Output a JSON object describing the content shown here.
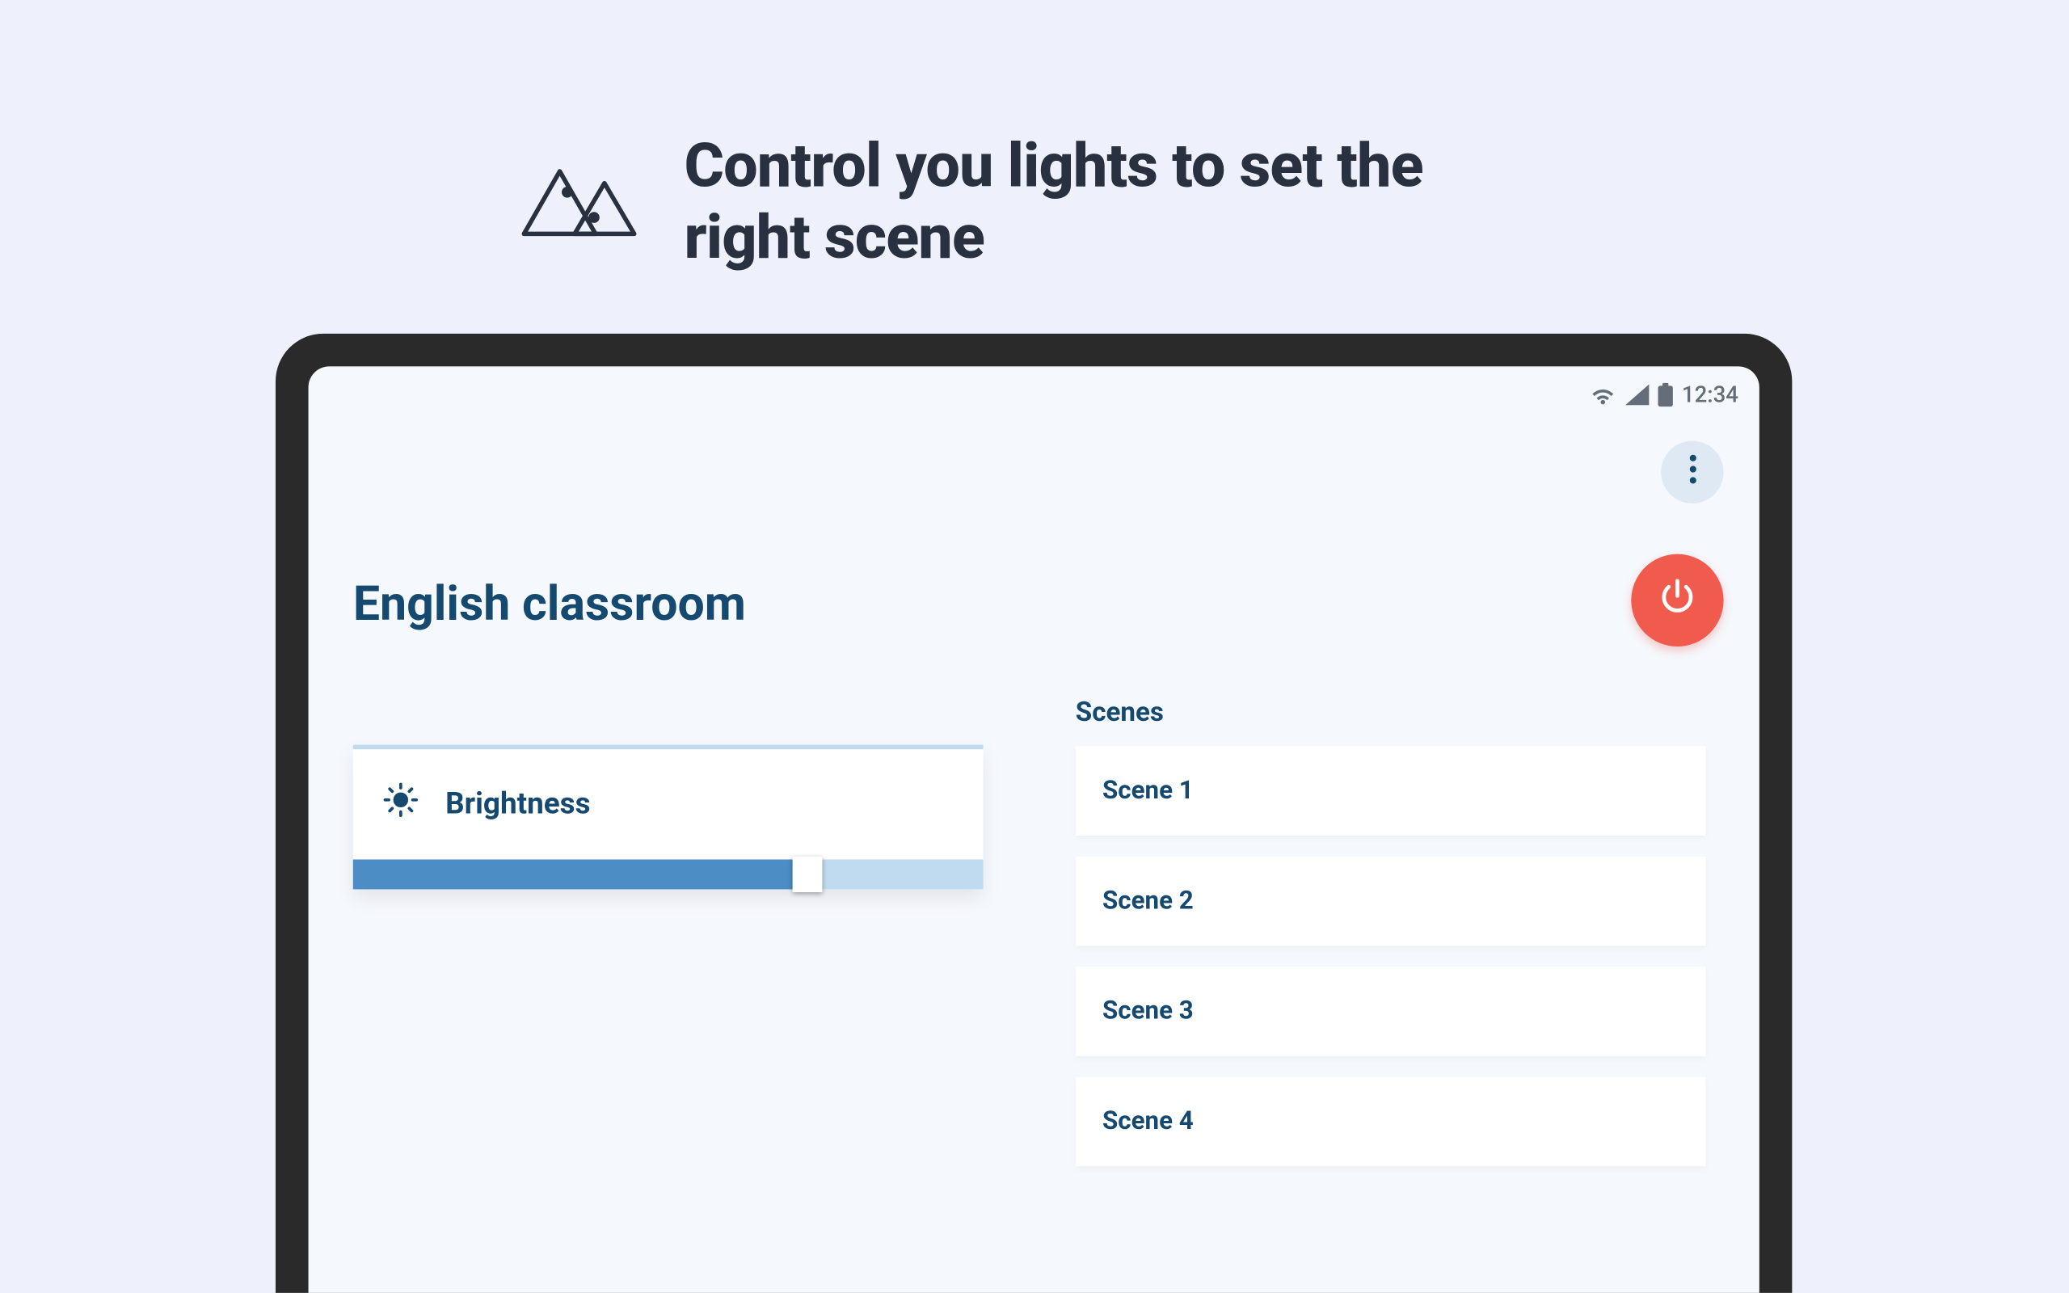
{
  "header": {
    "title": "Control you lights to set the right scene"
  },
  "statusbar": {
    "time": "12:34"
  },
  "room": {
    "title": "English classroom"
  },
  "brightness": {
    "label": "Brightness",
    "value_percent": 72
  },
  "scenes": {
    "heading": "Scenes",
    "items": [
      {
        "label": "Scene 1"
      },
      {
        "label": "Scene 2"
      },
      {
        "label": "Scene 3"
      },
      {
        "label": "Scene 4"
      }
    ]
  },
  "colors": {
    "accent": "#15496f",
    "slider_fill": "#4d8dc6",
    "slider_track": "#c0dbf0",
    "power": "#f05b4e",
    "bg": "#eef1fb"
  }
}
